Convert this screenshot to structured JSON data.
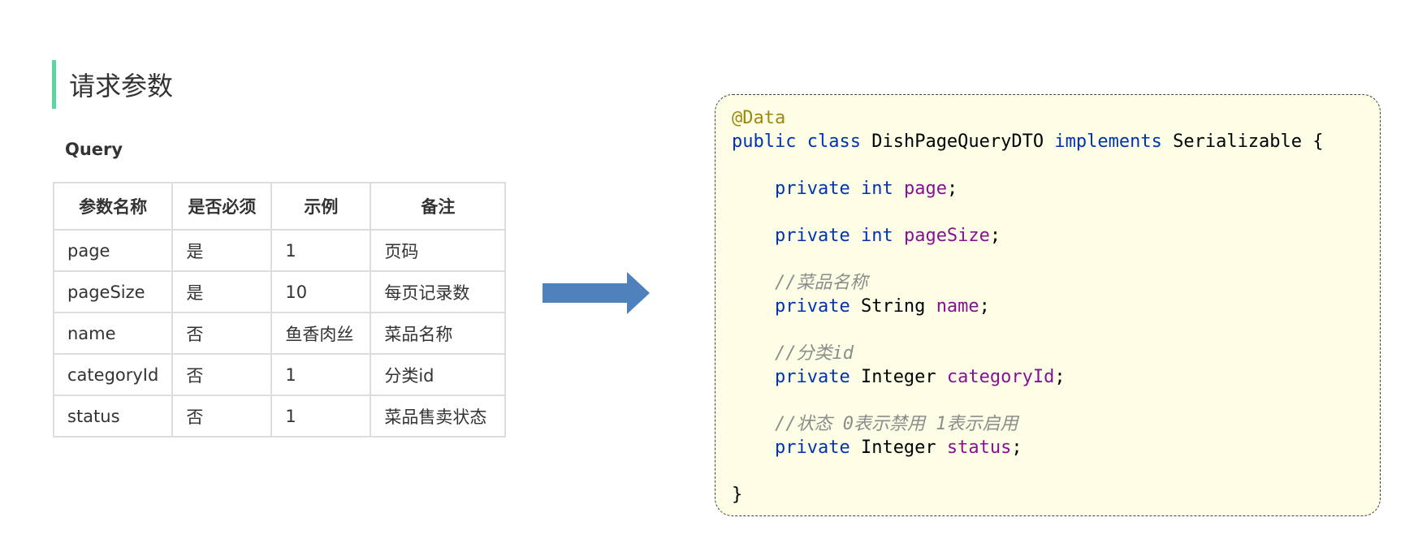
{
  "left": {
    "section_title": "请求参数",
    "sub_title": "Query",
    "table": {
      "headers": [
        "参数名称",
        "是否必须",
        "示例",
        "备注"
      ],
      "rows": [
        [
          "page",
          "是",
          "1",
          "页码"
        ],
        [
          "pageSize",
          "是",
          "10",
          "每页记录数"
        ],
        [
          "name",
          "否",
          "鱼香肉丝",
          "菜品名称"
        ],
        [
          "categoryId",
          "否",
          "1",
          "分类id"
        ],
        [
          "status",
          "否",
          "1",
          "菜品售卖状态"
        ]
      ]
    }
  },
  "arrow": {
    "color": "#4f81bd"
  },
  "code": {
    "annotation": "@Data",
    "kw_public": "public",
    "kw_class": "class",
    "class_name": "DishPageQueryDTO",
    "kw_implements": "implements",
    "iface": "Serializable",
    "open_brace": "{",
    "close_brace": "}",
    "kw_private": "private",
    "type_int": "int",
    "type_string": "String",
    "type_integer": "Integer",
    "f_page": "page",
    "f_pagesize": "pageSize",
    "f_name": "name",
    "f_categoryid": "categoryId",
    "f_status": "status",
    "semicolon": ";",
    "comment_name": "//菜品名称",
    "comment_category": "//分类id",
    "comment_status": "//状态 0表示禁用 1表示启用"
  },
  "colors": {
    "accent_bar": "#5cd6a0",
    "code_bg": "#fefee6",
    "keyword": "#0033b3",
    "annotation": "#9e880d",
    "field": "#871094",
    "comment": "#8c8c8c"
  }
}
